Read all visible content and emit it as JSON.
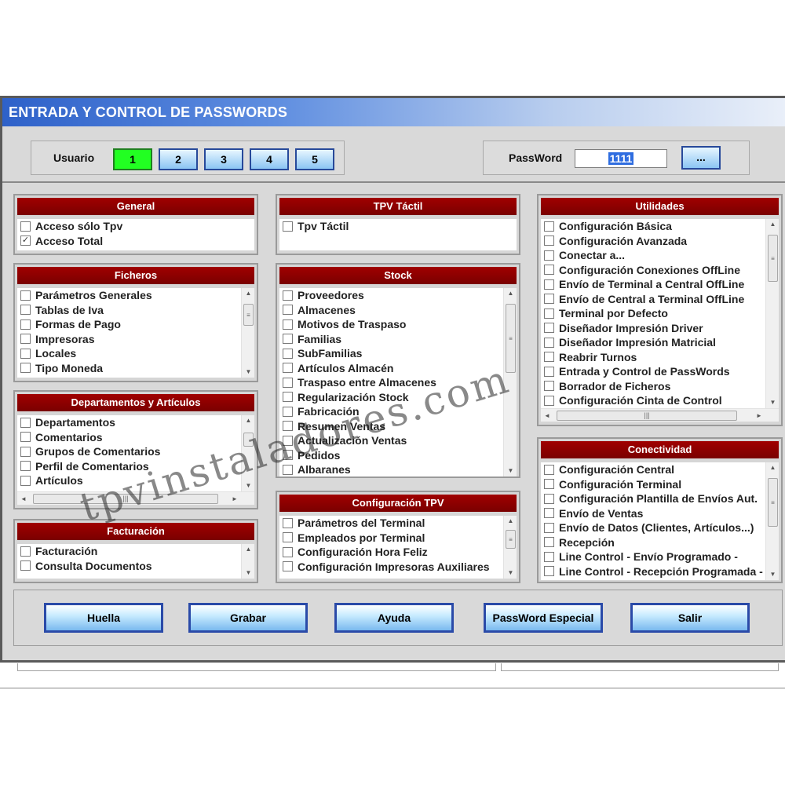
{
  "window": {
    "title": "ENTRADA Y CONTROL DE PASSWORDS"
  },
  "user_selector": {
    "label": "Usuario",
    "buttons": [
      "1",
      "2",
      "3",
      "4",
      "5"
    ],
    "active": "1"
  },
  "password": {
    "label": "PassWord",
    "value": "1111",
    "more_label": "..."
  },
  "panels": {
    "general": {
      "title": "General",
      "items": [
        {
          "label": "Acceso sólo Tpv",
          "checked": false
        },
        {
          "label": "Acceso Total",
          "checked": true
        }
      ]
    },
    "tpv_tactil": {
      "title": "TPV Táctil",
      "items": [
        {
          "label": "Tpv Táctil",
          "checked": false
        }
      ]
    },
    "utilidades": {
      "title": "Utilidades",
      "items": [
        {
          "label": "Configuración Básica",
          "checked": false
        },
        {
          "label": "Configuración Avanzada",
          "checked": false
        },
        {
          "label": "Conectar a...",
          "checked": false
        },
        {
          "label": "Configuración Conexiones OffLine",
          "checked": false
        },
        {
          "label": "Envío de Terminal a Central OffLine",
          "checked": false
        },
        {
          "label": "Envío de Central a Terminal OffLine",
          "checked": false
        },
        {
          "label": "Terminal por Defecto",
          "checked": false
        },
        {
          "label": "Diseñador Impresión Driver",
          "checked": false
        },
        {
          "label": "Diseñador Impresión Matricial",
          "checked": false
        },
        {
          "label": "Reabrir Turnos",
          "checked": false
        },
        {
          "label": "Entrada y Control de PassWords",
          "checked": false
        },
        {
          "label": "Borrador de Ficheros",
          "checked": false
        },
        {
          "label": "Configuración Cinta de Control",
          "checked": false
        }
      ]
    },
    "ficheros": {
      "title": "Ficheros",
      "items": [
        {
          "label": "Parámetros Generales",
          "checked": false
        },
        {
          "label": "Tablas de Iva",
          "checked": false
        },
        {
          "label": "Formas de Pago",
          "checked": false
        },
        {
          "label": "Impresoras",
          "checked": false
        },
        {
          "label": "Locales",
          "checked": false
        },
        {
          "label": "Tipo Moneda",
          "checked": false
        }
      ]
    },
    "stock": {
      "title": "Stock",
      "items": [
        {
          "label": "Proveedores",
          "checked": false
        },
        {
          "label": "Almacenes",
          "checked": false
        },
        {
          "label": "Motivos de Traspaso",
          "checked": false
        },
        {
          "label": "Familias",
          "checked": false
        },
        {
          "label": "SubFamilias",
          "checked": false
        },
        {
          "label": "Artículos Almacén",
          "checked": false
        },
        {
          "label": "Traspaso entre Almacenes",
          "checked": false
        },
        {
          "label": "Regularización Stock",
          "checked": false
        },
        {
          "label": "Fabricación",
          "checked": false
        },
        {
          "label": "Resumen Ventas",
          "checked": false
        },
        {
          "label": "Actualización Ventas",
          "checked": false
        },
        {
          "label": "Pedidos",
          "checked": false
        },
        {
          "label": "Albaranes",
          "checked": false
        }
      ]
    },
    "departamentos": {
      "title": "Departamentos y Artículos",
      "items": [
        {
          "label": "Departamentos",
          "checked": false
        },
        {
          "label": "Comentarios",
          "checked": false
        },
        {
          "label": "Grupos de Comentarios",
          "checked": false
        },
        {
          "label": "Perfil de Comentarios",
          "checked": false
        },
        {
          "label": "Artículos",
          "checked": false
        }
      ]
    },
    "conectividad": {
      "title": "Conectividad",
      "items": [
        {
          "label": "Configuración Central",
          "checked": false
        },
        {
          "label": "Configuración Terminal",
          "checked": false
        },
        {
          "label": "Configuración Plantilla de Envíos Aut.",
          "checked": false
        },
        {
          "label": "Envío de Ventas",
          "checked": false
        },
        {
          "label": "Envío de Datos (Clientes, Artículos...)",
          "checked": false
        },
        {
          "label": "Recepción",
          "checked": false
        },
        {
          "label": "Line Control - Envío Programado -",
          "checked": false
        },
        {
          "label": "Line Control - Recepción Programada -",
          "checked": false
        }
      ]
    },
    "config_tpv": {
      "title": "Configuración TPV",
      "items": [
        {
          "label": "Parámetros del Terminal",
          "checked": false
        },
        {
          "label": "Empleados por Terminal",
          "checked": false
        },
        {
          "label": "Configuración Hora Feliz",
          "checked": false
        },
        {
          "label": "Configuración Impresoras Auxiliares",
          "checked": false
        }
      ]
    },
    "facturacion": {
      "title": "Facturación",
      "items": [
        {
          "label": "Facturación",
          "checked": false
        },
        {
          "label": "Consulta Documentos",
          "checked": false
        }
      ]
    }
  },
  "actions": {
    "huella": "Huella",
    "grabar": "Grabar",
    "ayuda": "Ayuda",
    "password_especial": "PassWord Especial",
    "salir": "Salir"
  },
  "watermark": "tpvinstaladores.com",
  "colors": {
    "panel_header": "#8b0000",
    "active_user": "#22ff22",
    "button_border": "#2a4aa8"
  }
}
